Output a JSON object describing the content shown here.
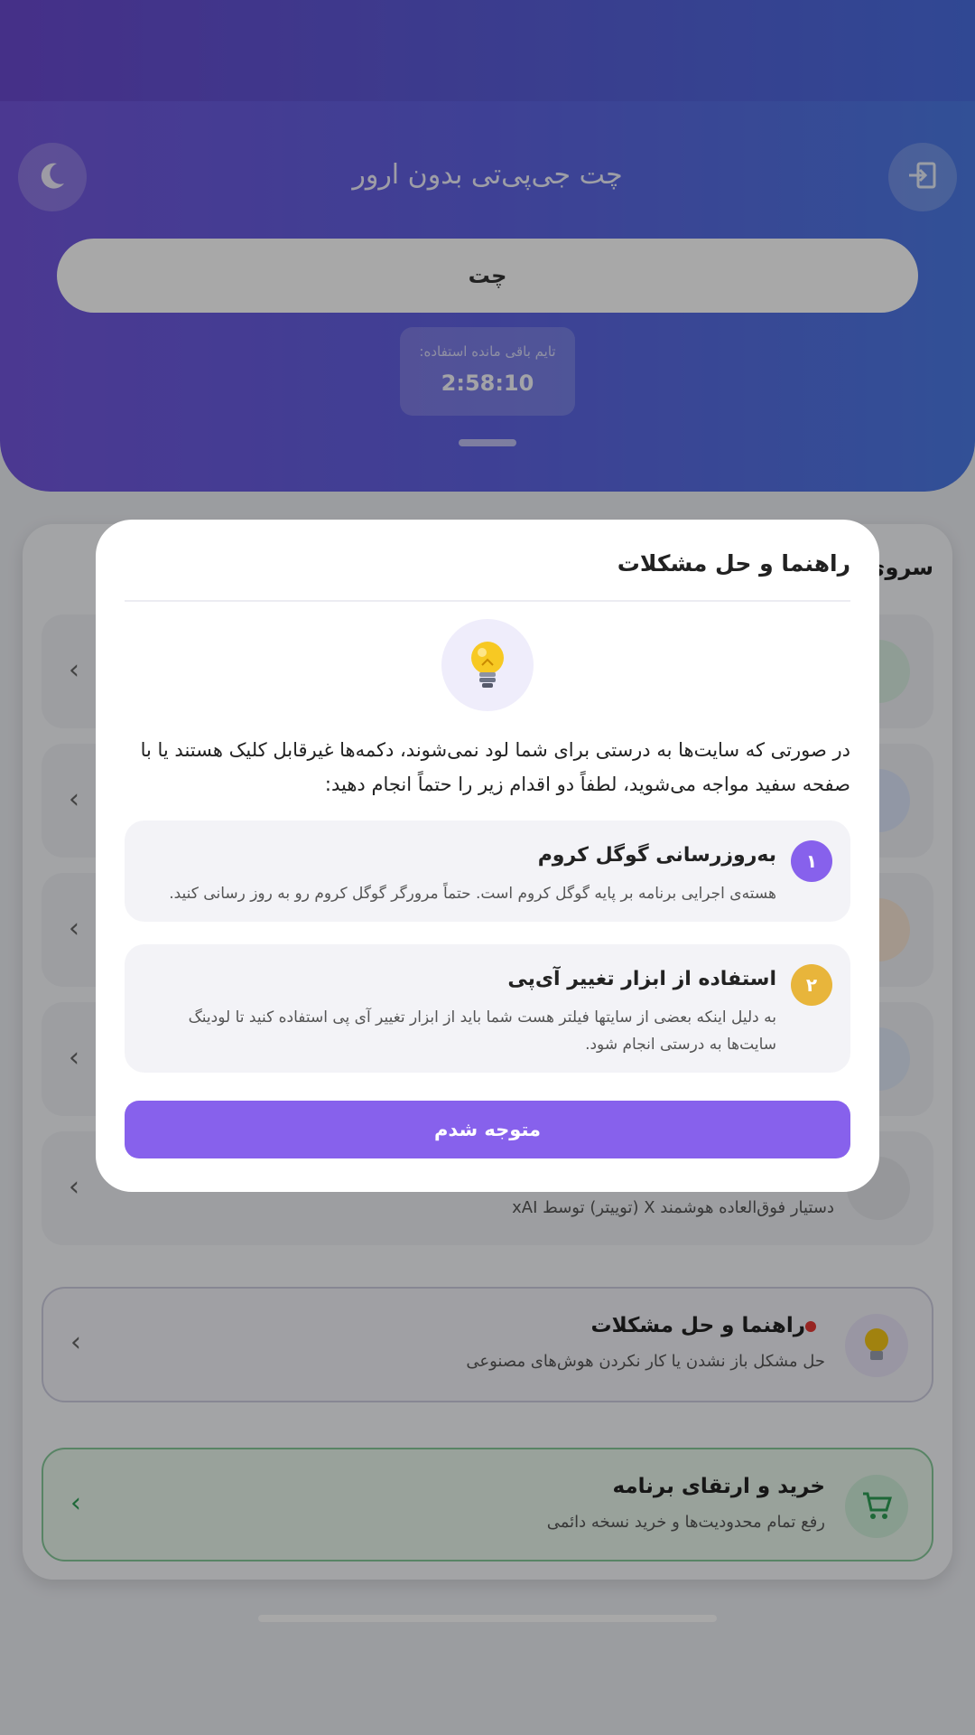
{
  "header": {
    "title": "چت جی‌پی‌تی بدون ارور",
    "chat_button": "چت",
    "timer_label": "تایم باقی مانده استفاده:",
    "timer_value": "2:58:10"
  },
  "services": {
    "section_title": "سروی",
    "grok_subtitle": "دستیار فوق‌العاده هوشمند X (توییتر) توسط xAI"
  },
  "help_card": {
    "title": "راهنما و حل مشکلات",
    "subtitle": "حل مشکل باز نشدن یا کار نکردن هوش‌های مصنوعی"
  },
  "buy_card": {
    "title": "خرید و ارتقای برنامه",
    "subtitle": "رفع تمام محدودیت‌ها و خرید نسخه دائمی"
  },
  "modal": {
    "title": "راهنما و حل مشکلات",
    "body": "در صورتی که سایت‌ها به درستی برای شما لود نمی‌شوند، دکمه‌ها غیرقابل کلیک هستند یا با صفحه سفید مواجه می‌شوید، لطفاً دو اقدام زیر را حتماً انجام دهید:",
    "steps": [
      {
        "number": "۱",
        "title": "به‌روزرسانی گوگل کروم",
        "description": "هسته‌ی اجرایی برنامه بر پایه گوگل کروم است. حتماً مرورگر گوگل کروم رو به روز رسانی کنید."
      },
      {
        "number": "۲",
        "title": "استفاده از ابزار تغییر آی‌پی",
        "description": "به دلیل اینکه بعضی از سایتها فیلتر هست شما باید از ابزار تغییر آی پی استفاده کنید تا لودینگ سایت‌ها به درستی انجام شود."
      }
    ],
    "confirm_label": "متوجه شدم"
  },
  "colors": {
    "accent": "#8761ec",
    "step1": "#8761ec",
    "step2": "#e8b53b",
    "header_start": "#7356dd",
    "header_end": "#4c7ae4"
  }
}
